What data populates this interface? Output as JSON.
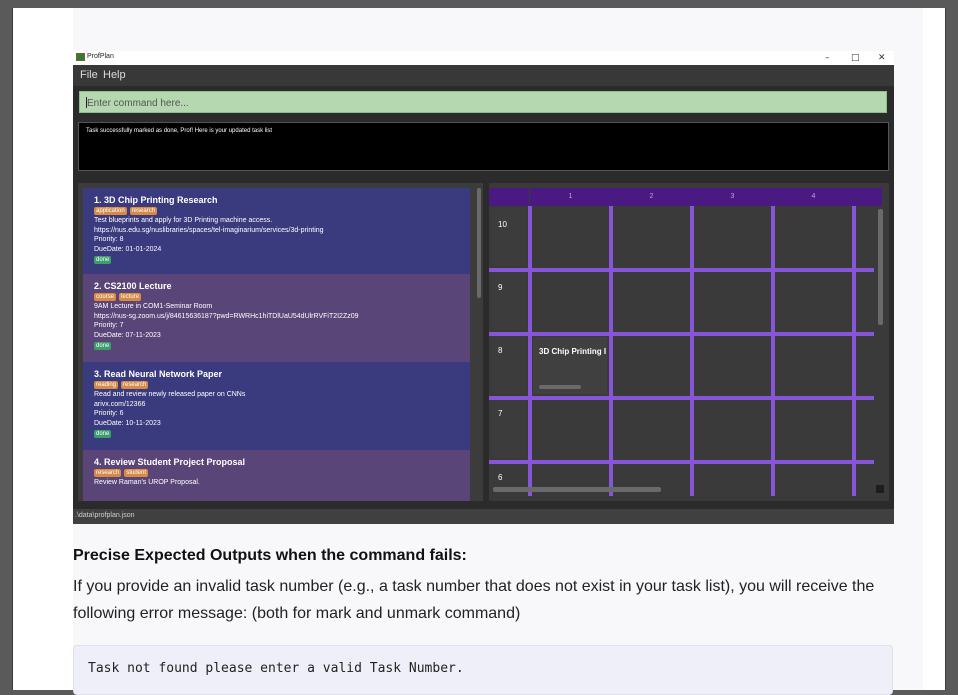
{
  "window": {
    "app_title": "ProfPlan",
    "controls": {
      "minimize": "–",
      "maximize": "□",
      "close": "✕"
    }
  },
  "menu": {
    "file": "File",
    "help": "Help"
  },
  "command_box": {
    "placeholder": "Enter command here..."
  },
  "result_display": {
    "text": "Task successfully marked as done, Prof! Here is your updated task list"
  },
  "tasks": [
    {
      "title": "1.  3D Chip Printing Research",
      "tags": [
        "application",
        "research"
      ],
      "description": "Test blueprints and apply for 3D Printing machine access.",
      "link": "https://nus.edu.sg/nuslibraries/spaces/tel-imaginarium/services/3d-printing",
      "priority": "Priority: 8",
      "due": "DueDate: 01-01-2024",
      "status": "done"
    },
    {
      "title": "2.  CS2100 Lecture",
      "tags": [
        "course",
        "lecture"
      ],
      "description": "9AM Lecture in COM1-Seminar Room",
      "link": "https://nus-sg.zoom.us/j/84615636187?pwd=RWRHc1hiTDlUaU54dUlrRVFiT2I2Zz09",
      "priority": "Priority: 7",
      "due": "DueDate: 07-11-2023",
      "status": "done"
    },
    {
      "title": "3.  Read Neural Network Paper",
      "tags": [
        "reading",
        "research"
      ],
      "description": "Read and review newly released paper on CNNs",
      "link": "arivx.com/12366",
      "priority": "Priority: 6",
      "due": "DueDate: 10-11-2023",
      "status": "done"
    },
    {
      "title": "4.  Review Student Project Proposal",
      "tags": [
        "research",
        "student"
      ],
      "description": "Review Raman's UROP Proposal.",
      "link": "",
      "priority": "",
      "due": "",
      "status": ""
    }
  ],
  "calendar": {
    "columns": [
      "1",
      "2",
      "3",
      "4"
    ],
    "rows": [
      "10",
      "9",
      "8",
      "7",
      "6"
    ],
    "task_in_row_8_col_1": "3D Chip Printing I"
  },
  "status_bar": {
    "path": ".\\data\\profplan.json"
  },
  "doc": {
    "heading": "Precise Expected Outputs when the command fails:",
    "paragraph": "If you provide an invalid task number (e.g., a task number that does not exist in your task list), you will receive the following error message: (both for mark and unmark command)",
    "code": "Task not found please enter a valid Task Number."
  },
  "colors": {
    "accent_purple": "#8755d8",
    "header_purple": "#4a1a82",
    "command_green": "#b5d8b0",
    "tag_orange": "#d68a45",
    "done_green": "#3d9d6b",
    "card_blue": "#3a3a7e",
    "card_purple": "#5a4578"
  }
}
